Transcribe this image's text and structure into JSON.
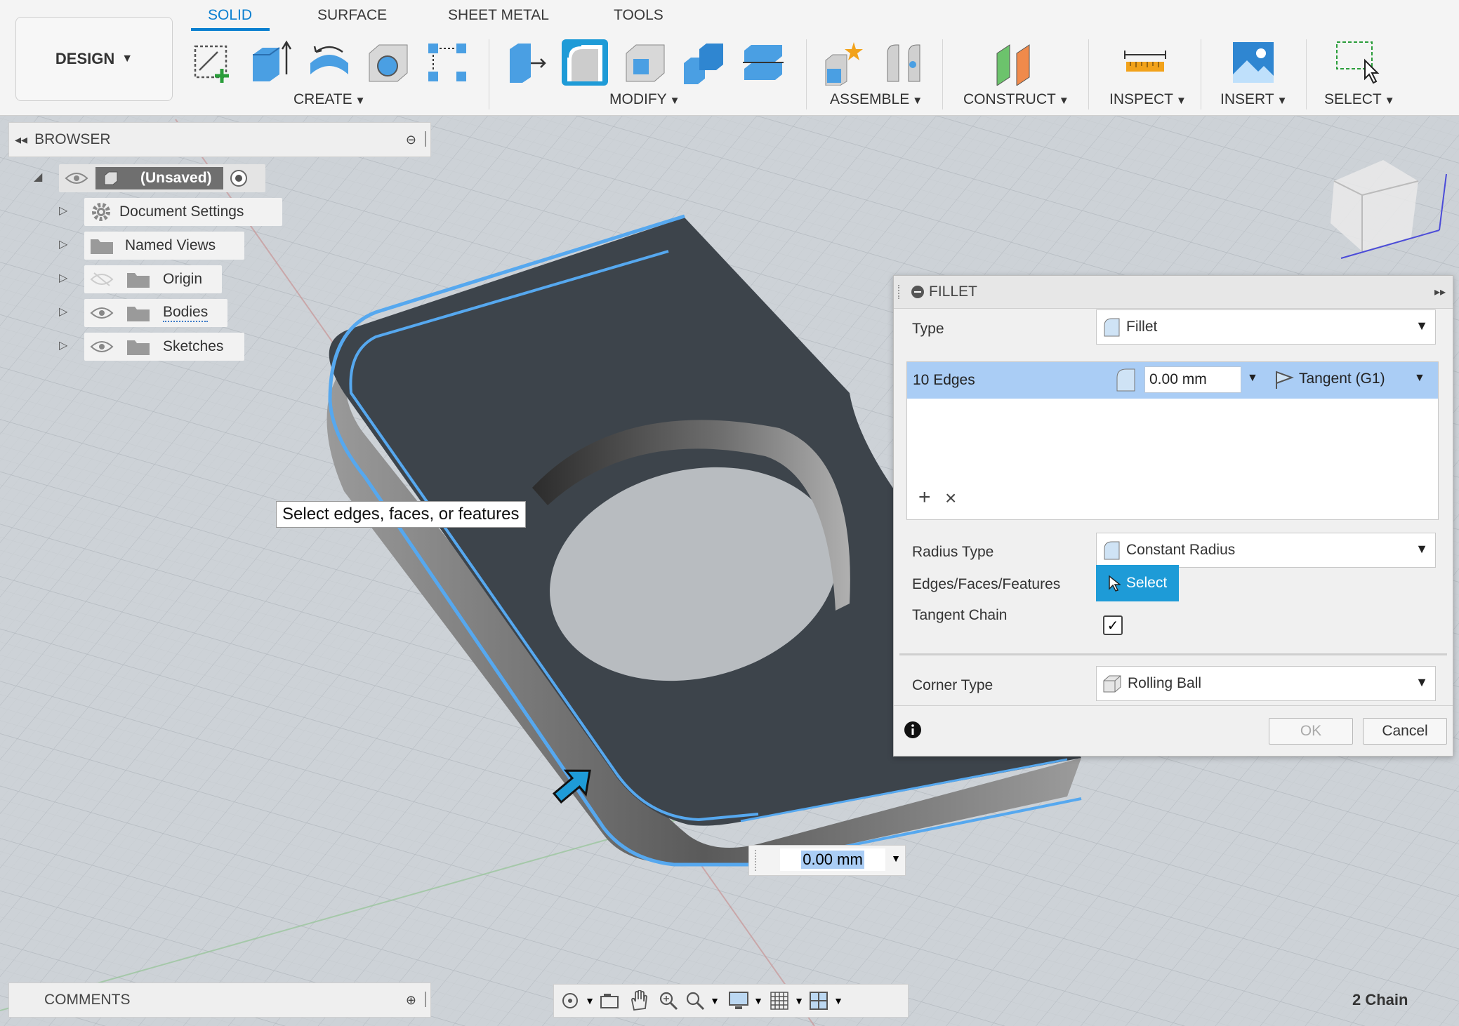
{
  "workspace": {
    "label": "DESIGN"
  },
  "tabs": [
    {
      "label": "SOLID",
      "active": true
    },
    {
      "label": "SURFACE"
    },
    {
      "label": "SHEET METAL"
    },
    {
      "label": "TOOLS"
    }
  ],
  "groups": {
    "create": "CREATE",
    "modify": "MODIFY",
    "assemble": "ASSEMBLE",
    "construct": "CONSTRUCT",
    "inspect": "INSPECT",
    "insert": "INSERT",
    "select": "SELECT"
  },
  "browser": {
    "title": "BROWSER",
    "root": "(Unsaved)",
    "items": [
      {
        "label": "Document Settings"
      },
      {
        "label": "Named Views"
      },
      {
        "label": "Origin"
      },
      {
        "label": "Bodies"
      },
      {
        "label": "Sketches"
      }
    ]
  },
  "fillet": {
    "title": "FILLET",
    "type_label": "Type",
    "type_value": "Fillet",
    "edges_label": "10 Edges",
    "edges_radius": "0.00 mm",
    "edges_continuity": "Tangent (G1)",
    "add": "+",
    "remove": "×",
    "radius_type_label": "Radius Type",
    "radius_type_value": "Constant Radius",
    "selection_label": "Edges/Faces/Features",
    "select_button": "Select",
    "tangent_chain_label": "Tangent Chain",
    "tangent_chain_checked": true,
    "corner_type_label": "Corner Type",
    "corner_type_value": "Rolling Ball",
    "ok": "OK",
    "cancel": "Cancel"
  },
  "viewport": {
    "tooltip": "Select edges, faces, or features",
    "dimension_value": "0.00 mm"
  },
  "comments": {
    "label": "COMMENTS"
  },
  "status": {
    "selection": "2 Chain"
  },
  "colors": {
    "accent": "#1e9bd7",
    "tab_active": "#0a7fd0",
    "selection_row": "#aacdf5",
    "body": "#3d444b"
  }
}
